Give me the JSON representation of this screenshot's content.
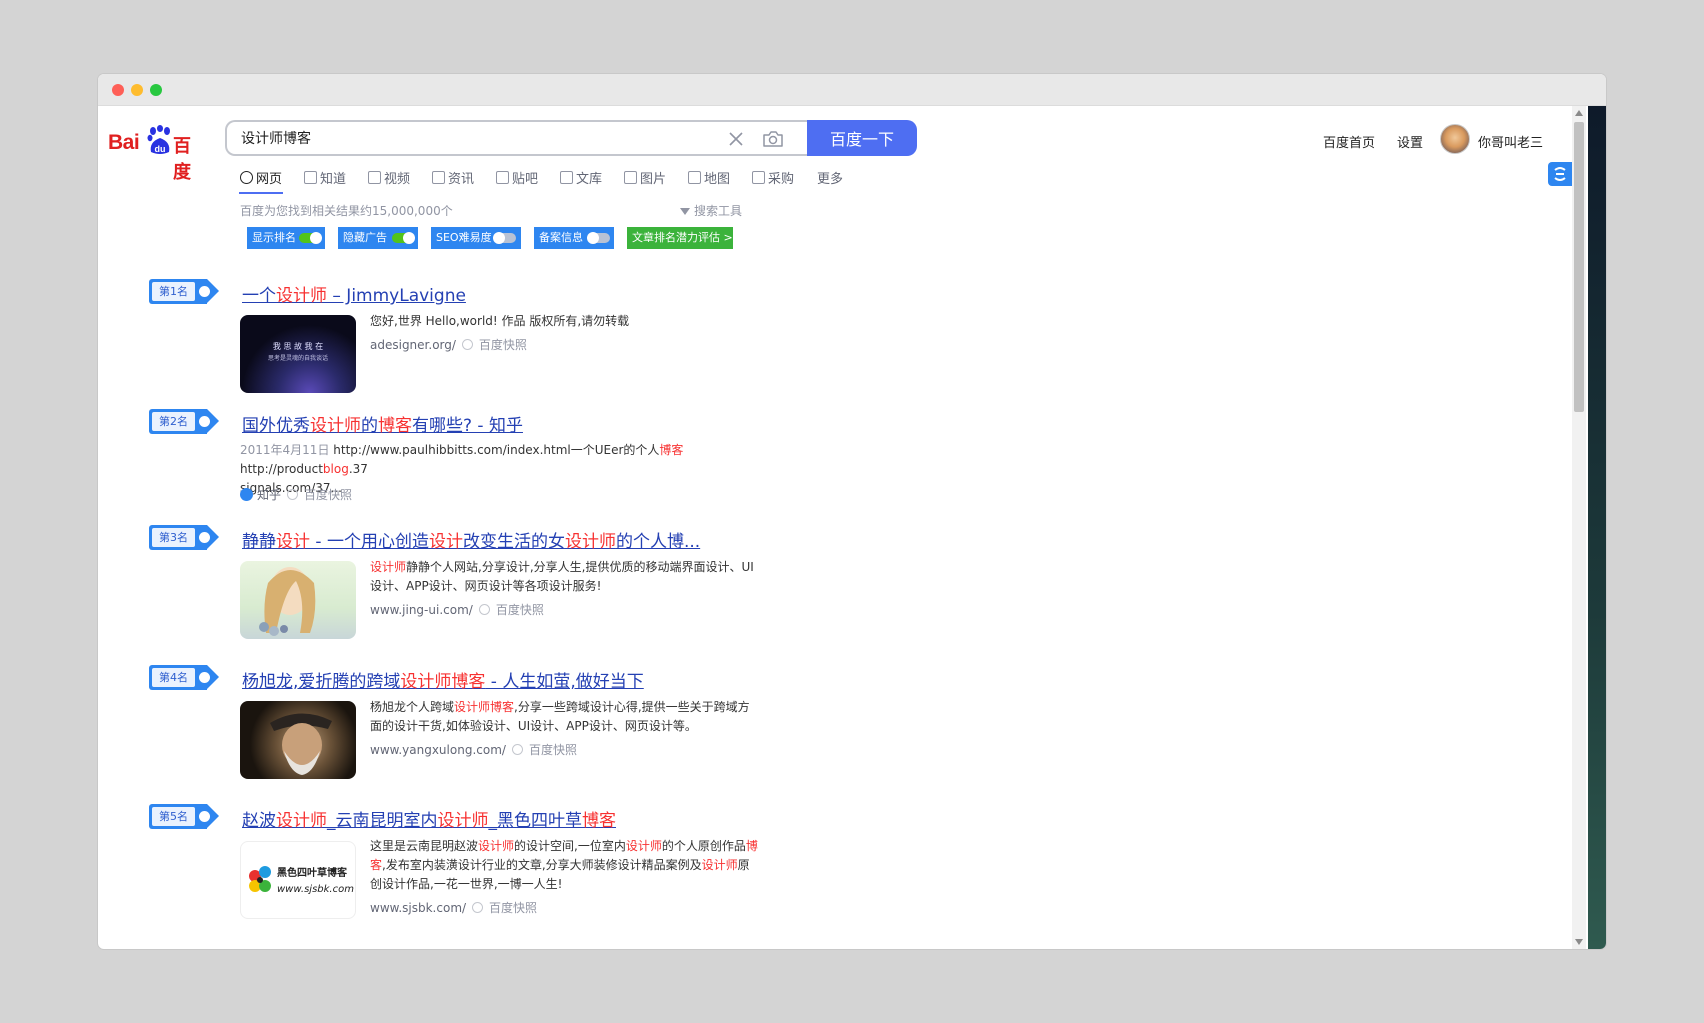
{
  "header": {
    "logo_left": "Bai",
    "logo_right": "百度",
    "search_value": "设计师博客",
    "search_button": "百度一下",
    "links": [
      "百度首页",
      "设置"
    ],
    "username": "你哥叫老三"
  },
  "tabs": [
    "网页",
    "知道",
    "视频",
    "资讯",
    "贴吧",
    "文库",
    "图片",
    "地图",
    "采购",
    "更多"
  ],
  "result_count": "百度为您找到相关结果约15,000,000个",
  "search_tools": "搜索工具",
  "toggles": [
    {
      "label": "显示排名",
      "on": true
    },
    {
      "label": "隐藏广告",
      "on": true
    },
    {
      "label": "SEO难易度",
      "on": false
    },
    {
      "label": "备案信息",
      "on": false
    },
    {
      "label": "文章排名潜力评估 >"
    }
  ],
  "results": [
    {
      "rank": "第1名",
      "title": [
        {
          "t": "一个"
        },
        {
          "t": "设计师",
          "hl": true
        },
        {
          "t": " – JimmyLavigne"
        }
      ],
      "desc": [
        {
          "t": "您好,世界 Hello,world! 作品 版权所有,请勿转载"
        }
      ],
      "url": "adesigner.org/",
      "snapshot": "百度快照",
      "thumb_text": [
        "我 思 故 我 在",
        "思考是灵魂的自我谈话"
      ]
    },
    {
      "rank": "第2名",
      "title": [
        {
          "t": "国外优秀"
        },
        {
          "t": "设计师",
          "hl": true
        },
        {
          "t": "的"
        },
        {
          "t": "博客",
          "hl": true
        },
        {
          "t": "有哪些? - 知乎"
        }
      ],
      "desc_line1": [
        {
          "t": "2011年4月11日 ",
          "gray": true
        },
        {
          "t": "http://www.paulhibbitts.com/index.html一个UEer的个人"
        },
        {
          "t": "博客",
          "hl": true
        },
        {
          "t": " http://product"
        },
        {
          "t": "blog",
          "hl": true
        },
        {
          "t": ".37"
        }
      ],
      "desc_line2": "signals.com/37...",
      "source": "知乎",
      "snapshot": "百度快照"
    },
    {
      "rank": "第3名",
      "title": [
        {
          "t": "静静"
        },
        {
          "t": "设计",
          "hl": true
        },
        {
          "t": " - 一个用心创造"
        },
        {
          "t": "设计",
          "hl": true
        },
        {
          "t": "改变生活的女"
        },
        {
          "t": "设计师",
          "hl": true
        },
        {
          "t": "的个人博..."
        }
      ],
      "desc": [
        {
          "t": "设计师",
          "hl": true
        },
        {
          "t": "静静个人网站,分享设计,分享人生,提供优质的移动端界面设计、UI设计、APP设计、网页设计等各项设计服务!"
        }
      ],
      "url": "www.jing-ui.com/",
      "snapshot": "百度快照"
    },
    {
      "rank": "第4名",
      "title": [
        {
          "t": "杨旭龙,爱折腾的跨域"
        },
        {
          "t": "设计师博客",
          "hl": true
        },
        {
          "t": " - 人生如萤,做好当下"
        }
      ],
      "desc": [
        {
          "t": "杨旭龙个人跨域"
        },
        {
          "t": "设计师博客",
          "hl": true
        },
        {
          "t": ",分享一些跨域设计心得,提供一些关于跨域方面的设计干货,如体验设计、UI设计、APP设计、网页设计等。"
        }
      ],
      "url": "www.yangxulong.com/",
      "snapshot": "百度快照"
    },
    {
      "rank": "第5名",
      "title": [
        {
          "t": "赵波"
        },
        {
          "t": "设计师",
          "hl": true
        },
        {
          "t": "_云南昆明室内"
        },
        {
          "t": "设计师",
          "hl": true
        },
        {
          "t": "_黑色四叶草"
        },
        {
          "t": "博客",
          "hl": true
        }
      ],
      "desc": [
        {
          "t": "这里是云南昆明赵波"
        },
        {
          "t": "设计师",
          "hl": true
        },
        {
          "t": "的设计空间,一位室内"
        },
        {
          "t": "设计师",
          "hl": true
        },
        {
          "t": "的个人原创作品"
        },
        {
          "t": "博客",
          "hl": true
        },
        {
          "t": ",发布室内装潢设计行业的文章,分享大师装修设计精品案例及"
        },
        {
          "t": "设计师",
          "hl": true
        },
        {
          "t": "原创设计作品,一花一世界,一博一人生!"
        }
      ],
      "url": "www.sjsbk.com/",
      "snapshot": "百度快照",
      "thumb_text": [
        "黑色四叶草博客",
        "www.sjsbk.com"
      ]
    }
  ],
  "colors": {
    "brand_blue": "#4e6ef2",
    "link_blue": "#2440b3",
    "highlight_red": "#f73131",
    "badge_blue": "#2e86f0",
    "toggle_green": "#52c41a"
  }
}
